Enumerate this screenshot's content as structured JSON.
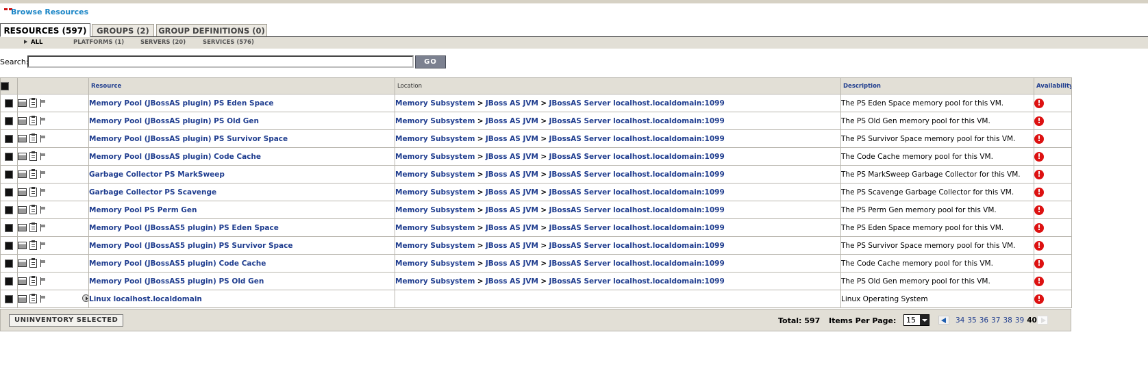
{
  "header": {
    "title": "Browse Resources"
  },
  "tabs": [
    {
      "label": "RESOURCES (597)",
      "active": true
    },
    {
      "label": "GROUPS (2)",
      "active": false
    },
    {
      "label": "GROUP DEFINITIONS (0)",
      "active": false
    }
  ],
  "subnav": {
    "all": "ALL",
    "platforms": "PLATFORMS (1)",
    "servers": "SERVERS (20)",
    "services": "SERVICES (576)"
  },
  "search": {
    "label": "Search:",
    "value": "",
    "go_label": "GO"
  },
  "table": {
    "headers": {
      "resource": "Resource",
      "location": "Location",
      "description": "Description",
      "availability": "Availability"
    },
    "location_parts": [
      "Memory Subsystem",
      "JBoss AS JVM",
      "JBossAS Server localhost.localdomain:1099"
    ],
    "location_sep": ">",
    "availability_icon": "error-icon",
    "availability_glyph": "!",
    "rows": [
      {
        "resource": "Memory Pool (JBossAS plugin) PS Eden Space",
        "description": "The PS Eden Space memory pool for this VM."
      },
      {
        "resource": "Memory Pool (JBossAS plugin) PS Old Gen",
        "description": "The PS Old Gen memory pool for this VM."
      },
      {
        "resource": "Memory Pool (JBossAS plugin) PS Survivor Space",
        "description": "The PS Survivor Space memory pool for this VM."
      },
      {
        "resource": "Memory Pool (JBossAS plugin) Code Cache",
        "description": "The Code Cache memory pool for this VM."
      },
      {
        "resource": "Garbage Collector PS MarkSweep",
        "description": "The PS MarkSweep Garbage Collector for this VM."
      },
      {
        "resource": "Garbage Collector PS Scavenge",
        "description": "The PS Scavenge Garbage Collector for this VM."
      },
      {
        "resource": "Memory Pool PS Perm Gen",
        "description": "The PS Perm Gen memory pool for this VM."
      },
      {
        "resource": "Memory Pool (JBossAS5 plugin) PS Eden Space",
        "description": "The PS Eden Space memory pool for this VM."
      },
      {
        "resource": "Memory Pool (JBossAS5 plugin) PS Survivor Space",
        "description": "The PS Survivor Space memory pool for this VM."
      },
      {
        "resource": "Memory Pool (JBossAS5 plugin) Code Cache",
        "description": "The Code Cache memory pool for this VM."
      },
      {
        "resource": "Memory Pool (JBossAS5 plugin) PS Old Gen",
        "description": "The PS Old Gen memory pool for this VM."
      }
    ],
    "last_row": {
      "resource": "Linux localhost.localdomain",
      "description": "Linux Operating System"
    }
  },
  "footer": {
    "uninventory_label": "UNINVENTORY SELECTED",
    "total": "Total: 597",
    "items_per_page_label": "Items Per Page:",
    "items_per_page_value": "15",
    "pages": [
      "34",
      "35",
      "36",
      "37",
      "38",
      "39"
    ],
    "current_page": "40"
  },
  "colors": {
    "link": "#1f3d8f",
    "title": "#1a85c6",
    "error": "#dd1111",
    "bar": "#e2dfd6"
  }
}
